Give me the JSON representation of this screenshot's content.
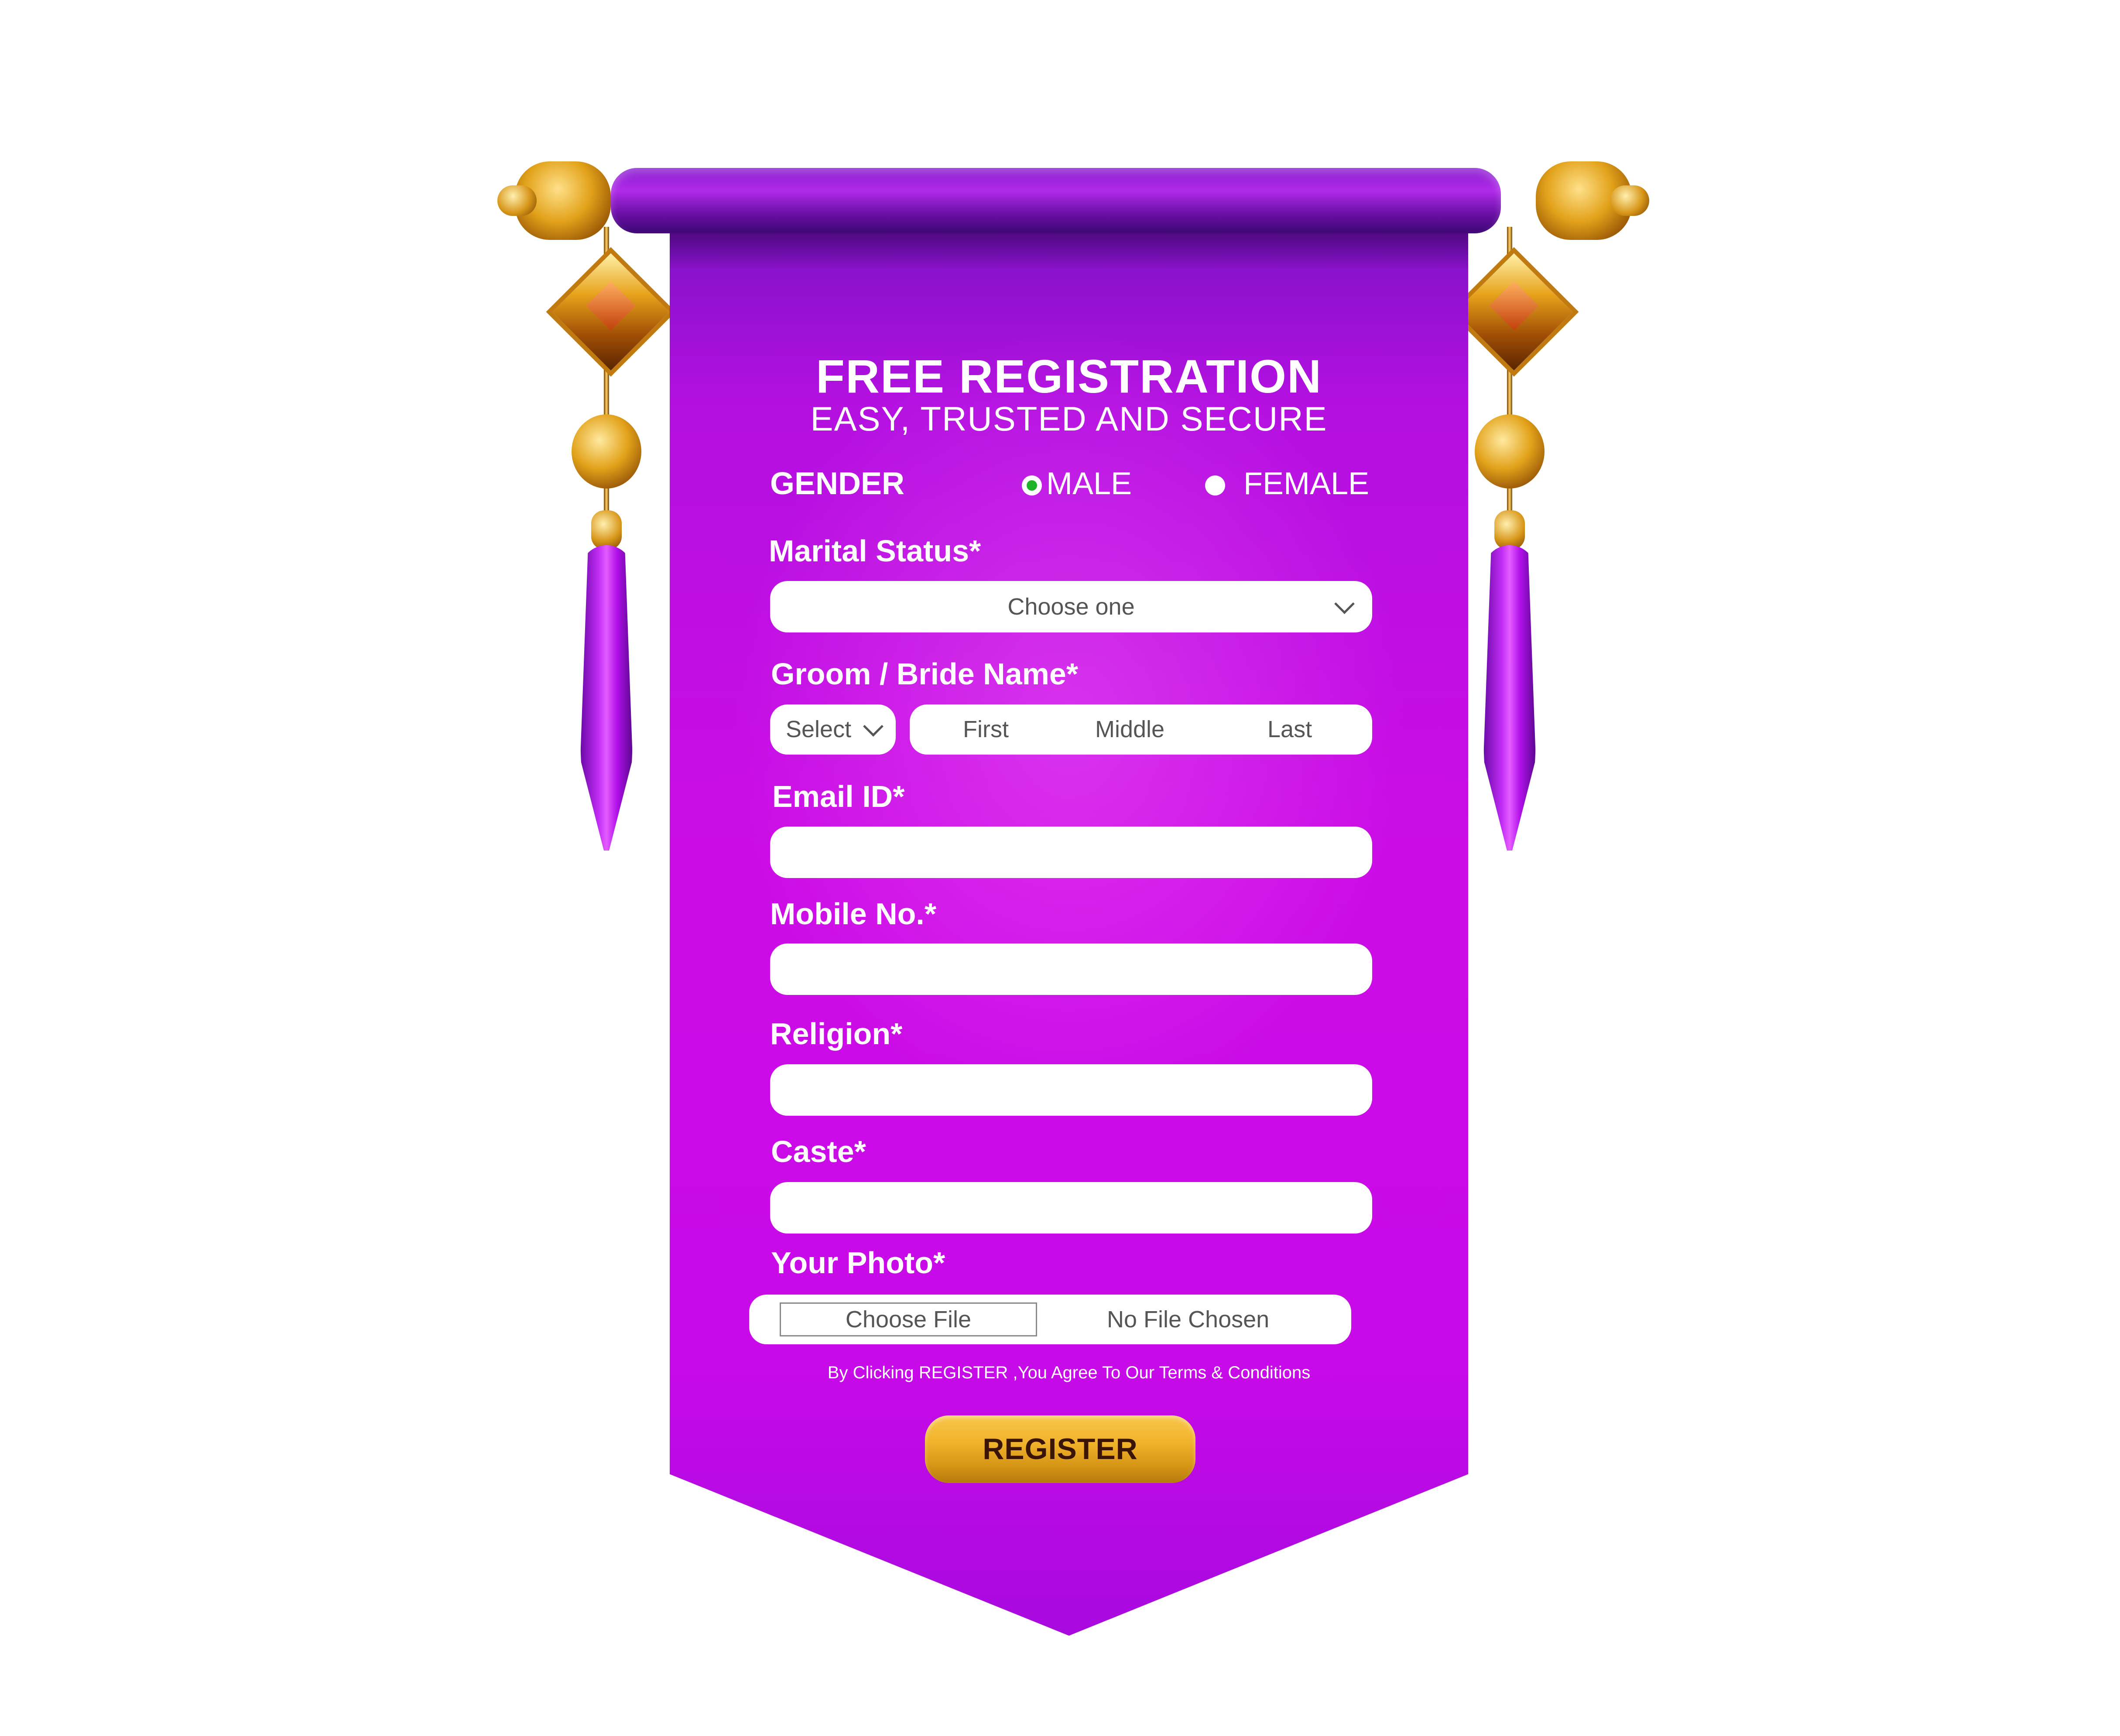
{
  "header": {
    "title": "FREE REGISTRATION",
    "subtitle": "EASY, TRUSTED AND SECURE"
  },
  "gender": {
    "label": "GENDER",
    "options": [
      "MALE",
      "FEMALE"
    ],
    "selected": "MALE",
    "selected_color": "#1fb32a"
  },
  "marital_status": {
    "label": "Marital Status*",
    "value": "Choose one"
  },
  "name": {
    "label": "Groom / Bride Name*",
    "title_select": "Select",
    "first_placeholder": "First",
    "middle_placeholder": "Middle",
    "last_placeholder": "Last"
  },
  "email": {
    "label": "Email ID*",
    "value": ""
  },
  "mobile": {
    "label": "Mobile No.*",
    "value": ""
  },
  "religion": {
    "label": "Religion*",
    "value": ""
  },
  "caste": {
    "label": "Caste*",
    "value": ""
  },
  "photo": {
    "label": "Your Photo*",
    "button_label": "Choose File",
    "status": "No File Chosen"
  },
  "terms_text": "By Clicking REGISTER ,You Agree To Our Terms & Conditions",
  "register_label": "REGISTER",
  "colors": {
    "banner": "#c80ae8",
    "button": "#f2b32c",
    "button_text": "#3a1405"
  }
}
